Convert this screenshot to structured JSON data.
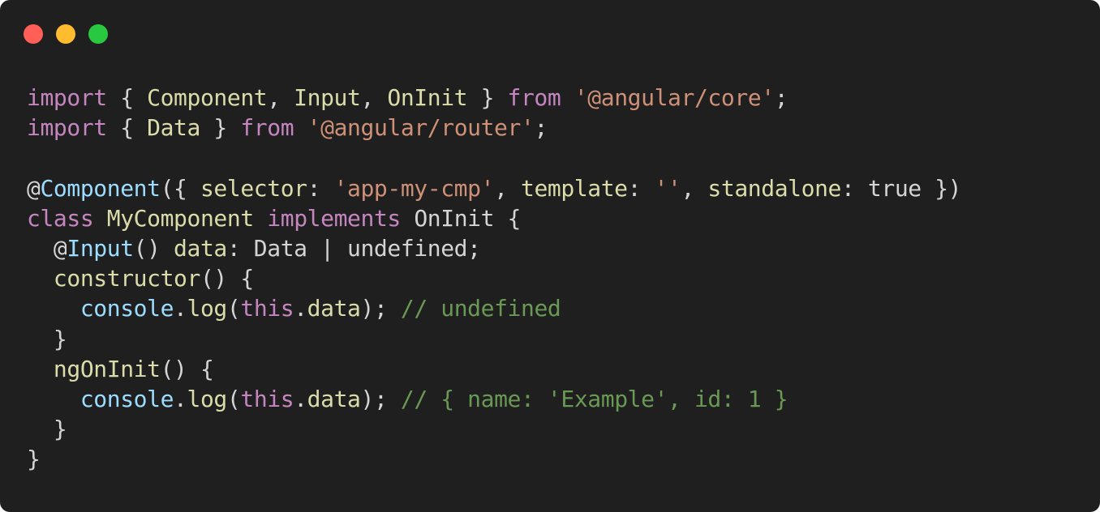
{
  "window": {
    "traffic_lights": [
      {
        "name": "close",
        "color": "#ff5f57"
      },
      {
        "name": "minimize",
        "color": "#febc2e"
      },
      {
        "name": "maximize",
        "color": "#28c840"
      }
    ]
  },
  "palette": {
    "keyword": "#c586c0",
    "storage": "#c586c0",
    "type": "#dcdcaa",
    "string": "#ce9178",
    "decorator": "#9cdcfe",
    "property": "#dcdcaa",
    "plain": "#d4d4d4",
    "comment": "#6a9955",
    "variable": "#9cdcfe"
  },
  "code_lines": [
    [
      {
        "t": "import",
        "c": "#c586c0"
      },
      {
        "t": " { ",
        "c": "#d4d4d4"
      },
      {
        "t": "Component",
        "c": "#dcdcaa"
      },
      {
        "t": ", ",
        "c": "#d4d4d4"
      },
      {
        "t": "Input",
        "c": "#dcdcaa"
      },
      {
        "t": ", ",
        "c": "#d4d4d4"
      },
      {
        "t": "OnInit",
        "c": "#dcdcaa"
      },
      {
        "t": " } ",
        "c": "#d4d4d4"
      },
      {
        "t": "from",
        "c": "#c586c0"
      },
      {
        "t": " ",
        "c": "#d4d4d4"
      },
      {
        "t": "'@angular/core'",
        "c": "#ce9178"
      },
      {
        "t": ";",
        "c": "#d4d4d4"
      }
    ],
    [
      {
        "t": "import",
        "c": "#c586c0"
      },
      {
        "t": " { ",
        "c": "#d4d4d4"
      },
      {
        "t": "Data",
        "c": "#dcdcaa"
      },
      {
        "t": " } ",
        "c": "#d4d4d4"
      },
      {
        "t": "from",
        "c": "#c586c0"
      },
      {
        "t": " ",
        "c": "#d4d4d4"
      },
      {
        "t": "'@angular/router'",
        "c": "#ce9178"
      },
      {
        "t": ";",
        "c": "#d4d4d4"
      }
    ],
    [],
    [
      {
        "t": "@",
        "c": "#d4d4d4"
      },
      {
        "t": "Component",
        "c": "#9cdcfe"
      },
      {
        "t": "({ ",
        "c": "#d4d4d4"
      },
      {
        "t": "selector",
        "c": "#dcdcaa"
      },
      {
        "t": ": ",
        "c": "#d4d4d4"
      },
      {
        "t": "'app-my-cmp'",
        "c": "#ce9178"
      },
      {
        "t": ", ",
        "c": "#d4d4d4"
      },
      {
        "t": "template",
        "c": "#dcdcaa"
      },
      {
        "t": ": ",
        "c": "#d4d4d4"
      },
      {
        "t": "''",
        "c": "#ce9178"
      },
      {
        "t": ", ",
        "c": "#d4d4d4"
      },
      {
        "t": "standalone",
        "c": "#dcdcaa"
      },
      {
        "t": ": true })",
        "c": "#d4d4d4"
      }
    ],
    [
      {
        "t": "class",
        "c": "#c586c0"
      },
      {
        "t": " ",
        "c": "#d4d4d4"
      },
      {
        "t": "MyComponent",
        "c": "#dcdcaa"
      },
      {
        "t": " ",
        "c": "#d4d4d4"
      },
      {
        "t": "implements",
        "c": "#c586c0"
      },
      {
        "t": " OnInit {",
        "c": "#d4d4d4"
      }
    ],
    [
      {
        "t": "  @",
        "c": "#d4d4d4"
      },
      {
        "t": "Input",
        "c": "#9cdcfe"
      },
      {
        "t": "() ",
        "c": "#d4d4d4"
      },
      {
        "t": "data",
        "c": "#dcdcaa"
      },
      {
        "t": ": Data | undefined;",
        "c": "#d4d4d4"
      }
    ],
    [
      {
        "t": "  ",
        "c": "#d4d4d4"
      },
      {
        "t": "constructor",
        "c": "#dcdcaa"
      },
      {
        "t": "() {",
        "c": "#d4d4d4"
      }
    ],
    [
      {
        "t": "    ",
        "c": "#d4d4d4"
      },
      {
        "t": "console",
        "c": "#9cdcfe"
      },
      {
        "t": ".",
        "c": "#d4d4d4"
      },
      {
        "t": "log",
        "c": "#dcdcaa"
      },
      {
        "t": "(",
        "c": "#d4d4d4"
      },
      {
        "t": "this",
        "c": "#c586c0"
      },
      {
        "t": ".",
        "c": "#d4d4d4"
      },
      {
        "t": "data",
        "c": "#dcdcaa"
      },
      {
        "t": "); ",
        "c": "#d4d4d4"
      },
      {
        "t": "// undefined",
        "c": "#6a9955"
      }
    ],
    [
      {
        "t": "  }",
        "c": "#d4d4d4"
      }
    ],
    [
      {
        "t": "  ",
        "c": "#d4d4d4"
      },
      {
        "t": "ngOnInit",
        "c": "#dcdcaa"
      },
      {
        "t": "() {",
        "c": "#d4d4d4"
      }
    ],
    [
      {
        "t": "    ",
        "c": "#d4d4d4"
      },
      {
        "t": "console",
        "c": "#9cdcfe"
      },
      {
        "t": ".",
        "c": "#d4d4d4"
      },
      {
        "t": "log",
        "c": "#dcdcaa"
      },
      {
        "t": "(",
        "c": "#d4d4d4"
      },
      {
        "t": "this",
        "c": "#c586c0"
      },
      {
        "t": ".",
        "c": "#d4d4d4"
      },
      {
        "t": "data",
        "c": "#dcdcaa"
      },
      {
        "t": "); ",
        "c": "#d4d4d4"
      },
      {
        "t": "// { name: 'Example', id: 1 }",
        "c": "#6a9955"
      }
    ],
    [
      {
        "t": "  }",
        "c": "#d4d4d4"
      }
    ],
    [
      {
        "t": "}",
        "c": "#d4d4d4"
      }
    ]
  ]
}
